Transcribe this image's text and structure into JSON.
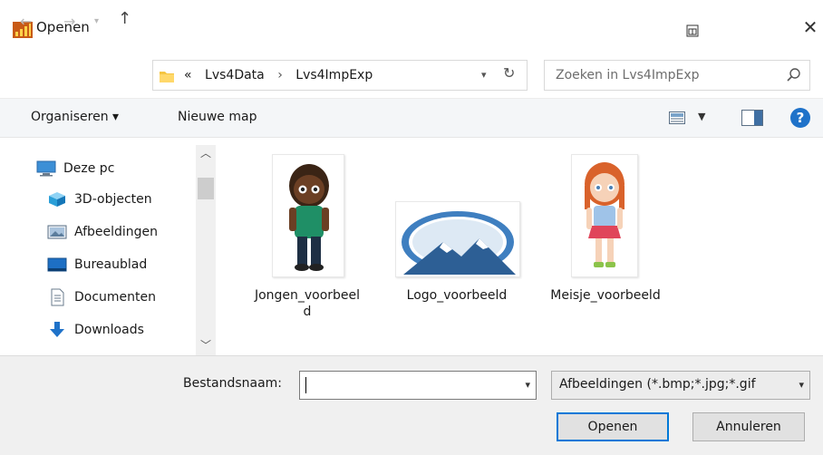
{
  "window": {
    "title": "Openen"
  },
  "address": {
    "overflow": "«",
    "crumbs": [
      "Lvs4Data",
      "Lvs4ImpExp"
    ],
    "separator": "›"
  },
  "search": {
    "placeholder": "Zoeken in Lvs4ImpExp"
  },
  "toolbar": {
    "organize_label": "Organiseren ▾",
    "new_folder_label": "Nieuwe map",
    "help_label": "?"
  },
  "nav": {
    "items": [
      {
        "label": "Deze pc",
        "icon": "computer-icon"
      },
      {
        "label": "3D-objecten",
        "icon": "cube-3d-icon"
      },
      {
        "label": "Afbeeldingen",
        "icon": "pictures-icon"
      },
      {
        "label": "Bureaublad",
        "icon": "desktop-icon"
      },
      {
        "label": "Documenten",
        "icon": "document-icon"
      },
      {
        "label": "Downloads",
        "icon": "download-icon"
      }
    ]
  },
  "files": [
    {
      "name": "Jongen_voorbeeld",
      "line1": "Jongen_voorbeel",
      "line2": "d",
      "icon": "boy-image-icon"
    },
    {
      "name": "Logo_voorbeeld",
      "line1": "Logo_voorbeeld",
      "line2": "",
      "icon": "logo-image-icon"
    },
    {
      "name": "Meisje_voorbeeld",
      "line1": "Meisje_voorbeeld",
      "line2": "",
      "icon": "girl-image-icon"
    }
  ],
  "footer": {
    "filename_label": "Bestandsnaam:",
    "filename_value": "",
    "filter_value": "Afbeeldingen (*.bmp;*.jpg;*.gif",
    "open_label": "Openen",
    "cancel_label": "Annuleren"
  },
  "colors": {
    "accent": "#0078d7",
    "help": "#1f72c9",
    "folder": "#f5c542"
  }
}
